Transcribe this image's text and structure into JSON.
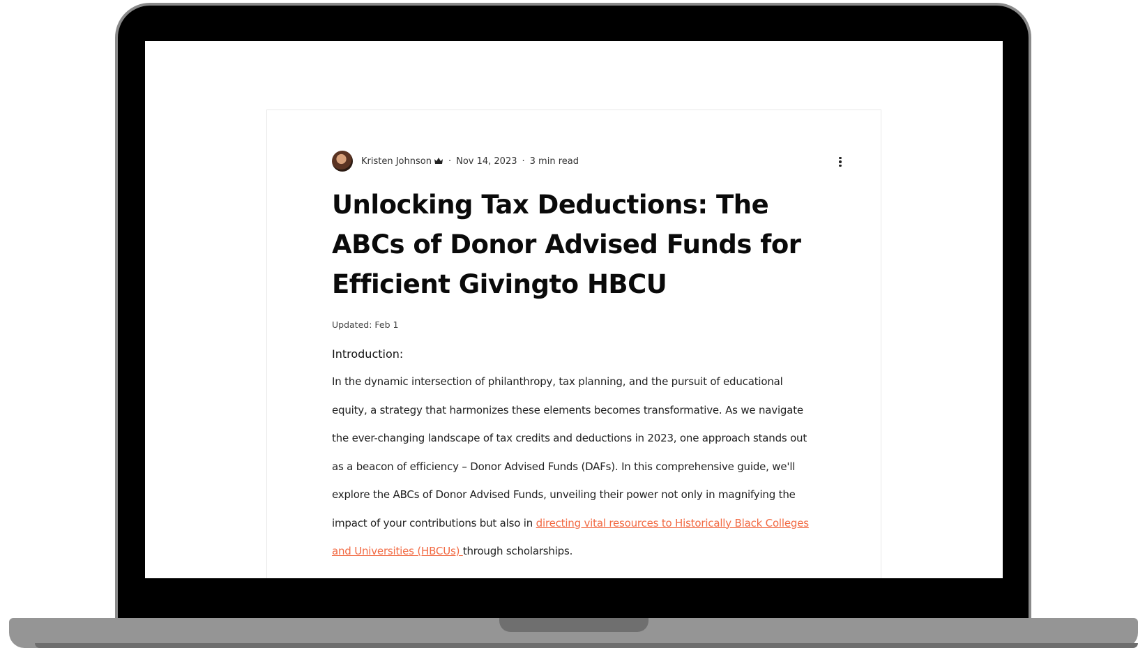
{
  "post": {
    "author": "Kristen Johnson",
    "date": "Nov 14, 2023",
    "separator": "·",
    "read_time": "3 min read",
    "title": "Unlocking Tax Deductions: The ABCs of Donor Advised Funds for Efficient Givingto HBCU",
    "updated": "Updated: Feb 1",
    "intro_heading": "Introduction:",
    "body_before_link": "In the dynamic intersection of philanthropy, tax planning, and the pursuit of educational equity, a strategy that harmonizes these elements becomes transformative. As we navigate the ever-changing landscape of tax credits and deductions in 2023, one approach stands out as a beacon of efficiency – Donor Advised Funds (DAFs). In this comprehensive guide, we'll explore the ABCs of Donor Advised Funds, unveiling their power not only in magnifying the impact of your contributions but also in ",
    "body_link": "directing vital resources to Historically Black Colleges and Universities (HBCUs) ",
    "body_after_link": "through scholarships."
  },
  "colors": {
    "link": "#f26a43",
    "bezel": "#000000",
    "laptop_body": "#959595"
  },
  "icons": {
    "author_badge": "crown-icon",
    "menu": "more-vertical-icon"
  }
}
